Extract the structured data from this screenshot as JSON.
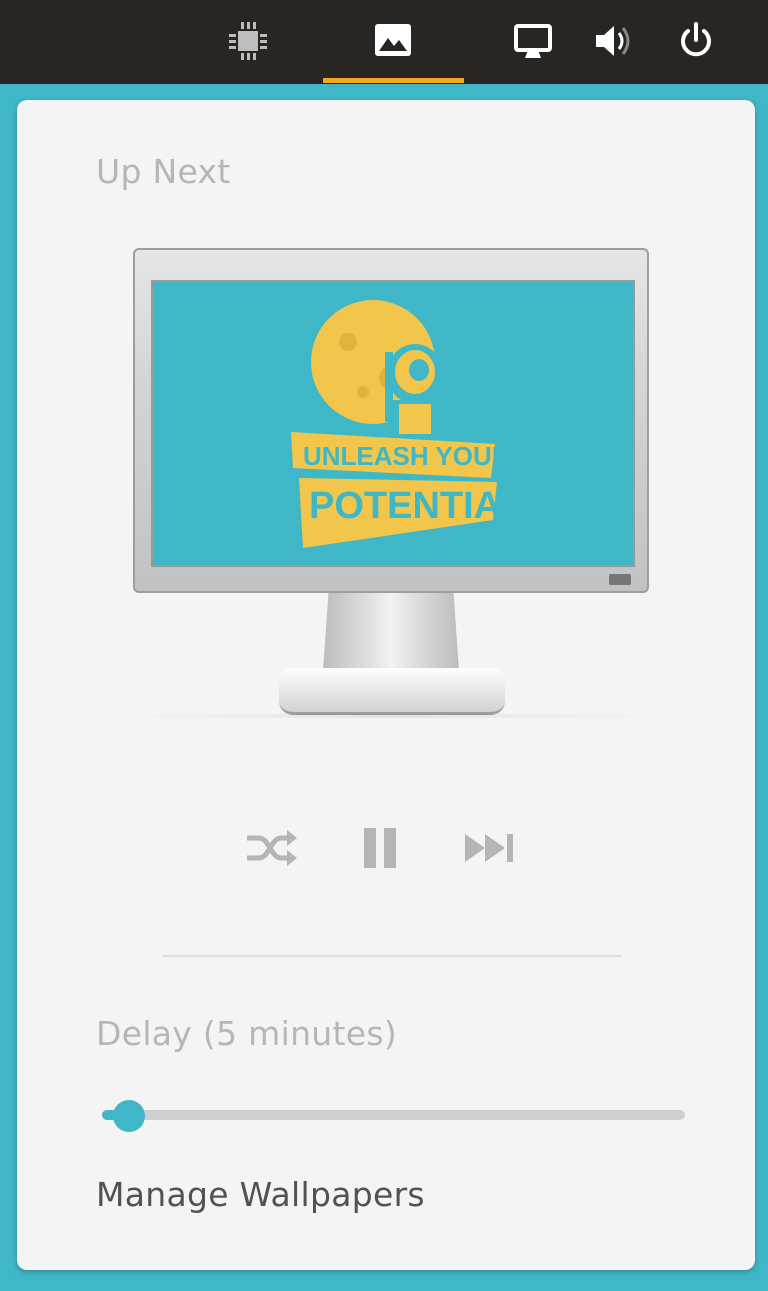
{
  "panel": {
    "icons": [
      "mouse-keyboard-icon",
      "image-icon",
      "display-icon",
      "volume-icon",
      "power-icon"
    ],
    "active_icon": "image-icon",
    "accent_color": "#f4a91c",
    "background_color": "#282523"
  },
  "popover": {
    "section_title": "Up Next",
    "wallpaper": {
      "text_line1": "UNLEASH YOUR",
      "text_line2": "POTENTIAL",
      "background_color": "#40b7c7",
      "art_color": "#f2c54b"
    },
    "controls": {
      "shuffle_icon": "shuffle-icon",
      "pause_icon": "pause-icon",
      "skip_icon": "skip-forward-icon"
    },
    "delay_label": "Delay (5 minutes)",
    "delay_slider_value": 0.03,
    "manage_label": "Manage Wallpapers",
    "accent_color": "#40b7c7"
  }
}
